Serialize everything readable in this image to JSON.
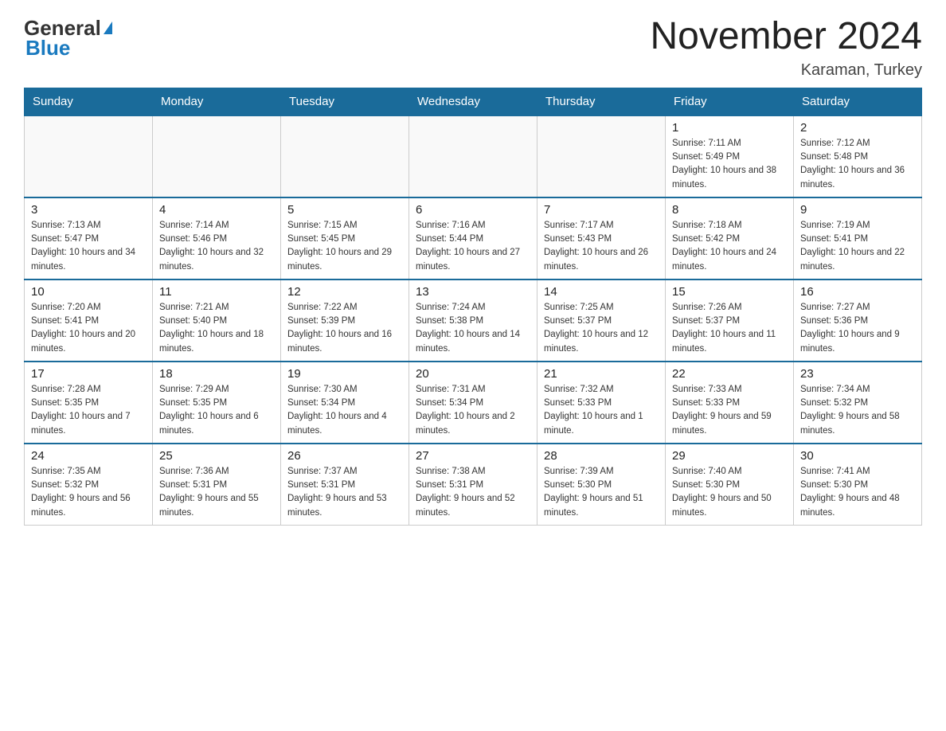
{
  "header": {
    "logo_general": "General",
    "logo_blue": "Blue",
    "month_title": "November 2024",
    "location": "Karaman, Turkey"
  },
  "days_of_week": [
    "Sunday",
    "Monday",
    "Tuesday",
    "Wednesday",
    "Thursday",
    "Friday",
    "Saturday"
  ],
  "weeks": [
    [
      {
        "day": "",
        "info": ""
      },
      {
        "day": "",
        "info": ""
      },
      {
        "day": "",
        "info": ""
      },
      {
        "day": "",
        "info": ""
      },
      {
        "day": "",
        "info": ""
      },
      {
        "day": "1",
        "info": "Sunrise: 7:11 AM\nSunset: 5:49 PM\nDaylight: 10 hours and 38 minutes."
      },
      {
        "day": "2",
        "info": "Sunrise: 7:12 AM\nSunset: 5:48 PM\nDaylight: 10 hours and 36 minutes."
      }
    ],
    [
      {
        "day": "3",
        "info": "Sunrise: 7:13 AM\nSunset: 5:47 PM\nDaylight: 10 hours and 34 minutes."
      },
      {
        "day": "4",
        "info": "Sunrise: 7:14 AM\nSunset: 5:46 PM\nDaylight: 10 hours and 32 minutes."
      },
      {
        "day": "5",
        "info": "Sunrise: 7:15 AM\nSunset: 5:45 PM\nDaylight: 10 hours and 29 minutes."
      },
      {
        "day": "6",
        "info": "Sunrise: 7:16 AM\nSunset: 5:44 PM\nDaylight: 10 hours and 27 minutes."
      },
      {
        "day": "7",
        "info": "Sunrise: 7:17 AM\nSunset: 5:43 PM\nDaylight: 10 hours and 26 minutes."
      },
      {
        "day": "8",
        "info": "Sunrise: 7:18 AM\nSunset: 5:42 PM\nDaylight: 10 hours and 24 minutes."
      },
      {
        "day": "9",
        "info": "Sunrise: 7:19 AM\nSunset: 5:41 PM\nDaylight: 10 hours and 22 minutes."
      }
    ],
    [
      {
        "day": "10",
        "info": "Sunrise: 7:20 AM\nSunset: 5:41 PM\nDaylight: 10 hours and 20 minutes."
      },
      {
        "day": "11",
        "info": "Sunrise: 7:21 AM\nSunset: 5:40 PM\nDaylight: 10 hours and 18 minutes."
      },
      {
        "day": "12",
        "info": "Sunrise: 7:22 AM\nSunset: 5:39 PM\nDaylight: 10 hours and 16 minutes."
      },
      {
        "day": "13",
        "info": "Sunrise: 7:24 AM\nSunset: 5:38 PM\nDaylight: 10 hours and 14 minutes."
      },
      {
        "day": "14",
        "info": "Sunrise: 7:25 AM\nSunset: 5:37 PM\nDaylight: 10 hours and 12 minutes."
      },
      {
        "day": "15",
        "info": "Sunrise: 7:26 AM\nSunset: 5:37 PM\nDaylight: 10 hours and 11 minutes."
      },
      {
        "day": "16",
        "info": "Sunrise: 7:27 AM\nSunset: 5:36 PM\nDaylight: 10 hours and 9 minutes."
      }
    ],
    [
      {
        "day": "17",
        "info": "Sunrise: 7:28 AM\nSunset: 5:35 PM\nDaylight: 10 hours and 7 minutes."
      },
      {
        "day": "18",
        "info": "Sunrise: 7:29 AM\nSunset: 5:35 PM\nDaylight: 10 hours and 6 minutes."
      },
      {
        "day": "19",
        "info": "Sunrise: 7:30 AM\nSunset: 5:34 PM\nDaylight: 10 hours and 4 minutes."
      },
      {
        "day": "20",
        "info": "Sunrise: 7:31 AM\nSunset: 5:34 PM\nDaylight: 10 hours and 2 minutes."
      },
      {
        "day": "21",
        "info": "Sunrise: 7:32 AM\nSunset: 5:33 PM\nDaylight: 10 hours and 1 minute."
      },
      {
        "day": "22",
        "info": "Sunrise: 7:33 AM\nSunset: 5:33 PM\nDaylight: 9 hours and 59 minutes."
      },
      {
        "day": "23",
        "info": "Sunrise: 7:34 AM\nSunset: 5:32 PM\nDaylight: 9 hours and 58 minutes."
      }
    ],
    [
      {
        "day": "24",
        "info": "Sunrise: 7:35 AM\nSunset: 5:32 PM\nDaylight: 9 hours and 56 minutes."
      },
      {
        "day": "25",
        "info": "Sunrise: 7:36 AM\nSunset: 5:31 PM\nDaylight: 9 hours and 55 minutes."
      },
      {
        "day": "26",
        "info": "Sunrise: 7:37 AM\nSunset: 5:31 PM\nDaylight: 9 hours and 53 minutes."
      },
      {
        "day": "27",
        "info": "Sunrise: 7:38 AM\nSunset: 5:31 PM\nDaylight: 9 hours and 52 minutes."
      },
      {
        "day": "28",
        "info": "Sunrise: 7:39 AM\nSunset: 5:30 PM\nDaylight: 9 hours and 51 minutes."
      },
      {
        "day": "29",
        "info": "Sunrise: 7:40 AM\nSunset: 5:30 PM\nDaylight: 9 hours and 50 minutes."
      },
      {
        "day": "30",
        "info": "Sunrise: 7:41 AM\nSunset: 5:30 PM\nDaylight: 9 hours and 48 minutes."
      }
    ]
  ]
}
